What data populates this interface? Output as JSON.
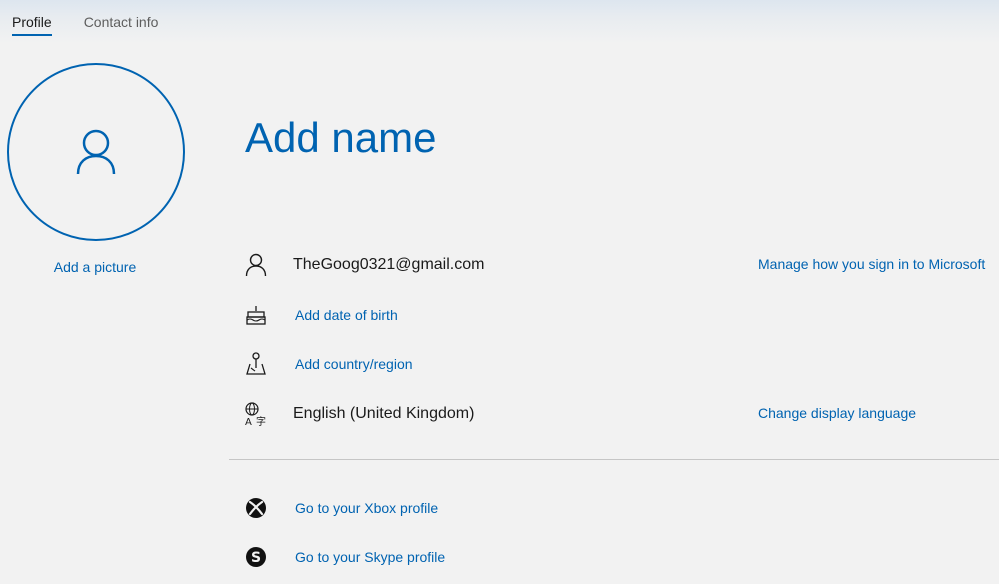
{
  "tabs": [
    {
      "label": "Profile",
      "active": true
    },
    {
      "label": "Contact info",
      "active": false
    }
  ],
  "avatar": {
    "add_picture_label": "Add a picture"
  },
  "profile": {
    "name_placeholder": "Add name",
    "email": "TheGoog0321@gmail.com",
    "manage_signin_label": "Manage how you sign in to Microsoft",
    "birth_label": "Add date of birth",
    "country_label": "Add country/region",
    "language": "English (United Kingdom)",
    "change_language_label": "Change display language"
  },
  "links": {
    "xbox_label": "Go to your Xbox profile",
    "skype_label": "Go to your Skype profile"
  },
  "icons": {
    "email": "person-icon",
    "birth": "cake-icon",
    "country": "map-pin-icon",
    "language": "language-icon",
    "xbox": "xbox-icon",
    "skype": "skype-icon"
  },
  "colors": {
    "accent": "#0063b1",
    "background": "#f2f2f2",
    "text": "#1a1a1a"
  }
}
